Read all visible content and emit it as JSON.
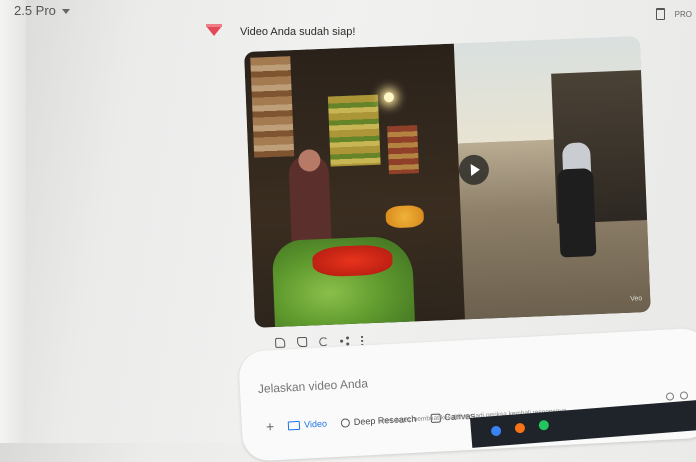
{
  "header": {
    "model_label": "2.5 Pro",
    "right_label": "PRO"
  },
  "response": {
    "text": "Video Anda sudah siap!",
    "video_watermark": "Veo"
  },
  "actions": [
    "thumb-up-icon",
    "thumb-down-icon",
    "refresh-icon",
    "share-icon",
    "more-icon"
  ],
  "composer": {
    "placeholder": "Jelaskan video Anda",
    "tools": {
      "video": "Video",
      "deep_research": "Deep Research",
      "canvas": "Canvas"
    },
    "plus": "+"
  },
  "disclaimer": "mini dapat membuat kesalahan, jadi periksa kembali responsnya",
  "colors": {
    "accent": "#1a73e8",
    "gem": "#e24a5a"
  }
}
